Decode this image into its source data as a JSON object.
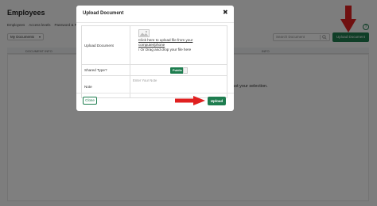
{
  "page": {
    "title": "Employees",
    "tabs": [
      "Employees",
      "Access levels",
      "Password & P"
    ],
    "filter_value": "My Documents",
    "search_placeholder": "Search Document",
    "upload_button": "Upload Document",
    "table_headers": [
      "DOCUMENT INFO",
      "INFO"
    ],
    "empty_message": "djust your selection."
  },
  "modal": {
    "title": "Upload Document",
    "close_glyph": "✖",
    "rows": {
      "file_label": "Upload Document",
      "upload_link": "Click here to upload file from your computer/phone",
      "drag_text": "/ Or Drag and drop your file here",
      "shared_label": "Shared Type?",
      "shared_value": "Public",
      "note_label": "Note",
      "note_placeholder": "Enter Your Note"
    },
    "close_button": "Close",
    "upload_button": "Upload"
  },
  "colors": {
    "accent": "#1e7d4f",
    "arrow": "#e02020"
  }
}
